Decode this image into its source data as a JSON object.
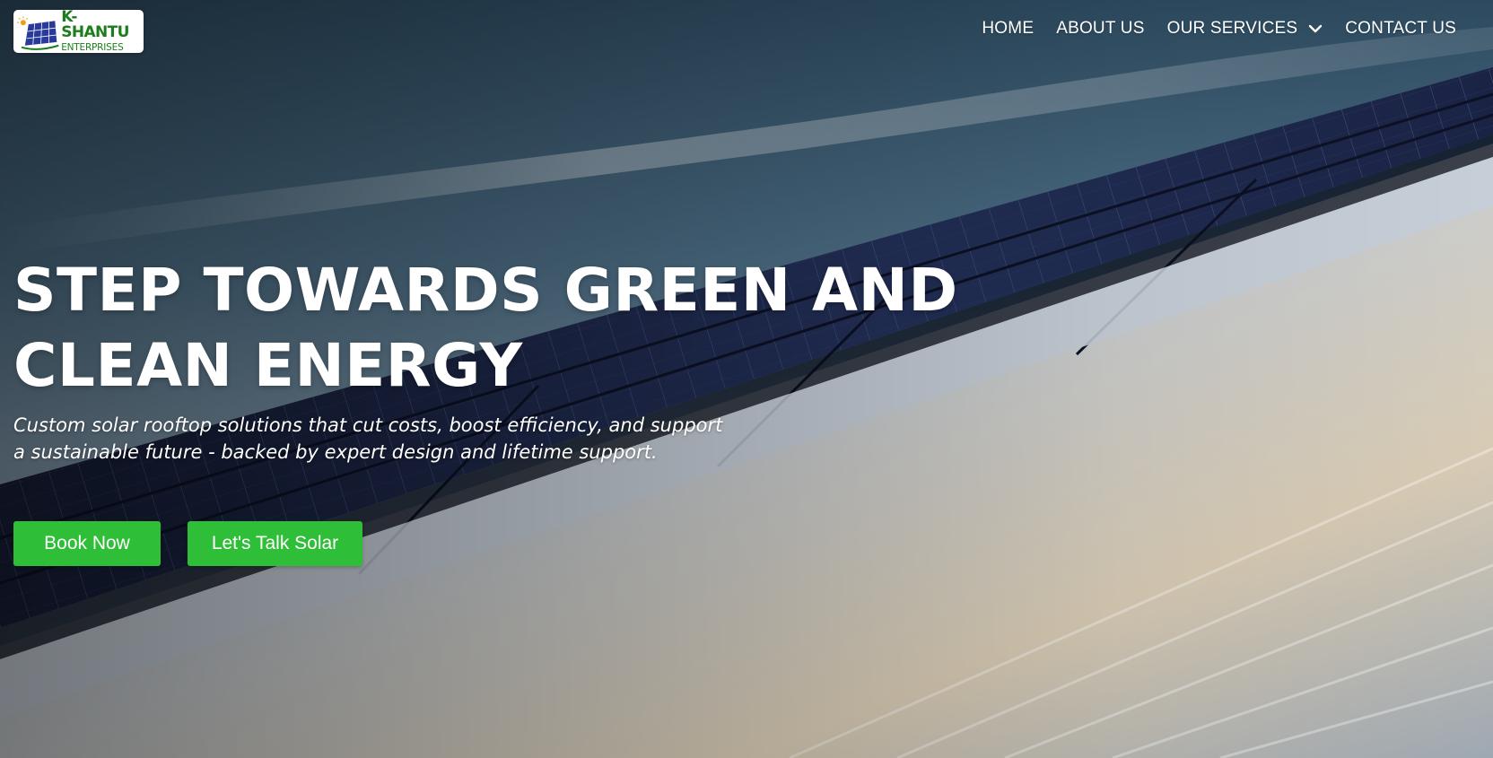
{
  "brand": {
    "name": "K-SHANTU",
    "tagline": "ENTERPRISES"
  },
  "nav": {
    "items": [
      {
        "label": "HOME"
      },
      {
        "label": "ABOUT US"
      },
      {
        "label": "OUR SERVICES",
        "icon": "chevron-down-icon"
      },
      {
        "label": "CONTACT US"
      }
    ]
  },
  "hero": {
    "headline_line1": "STEP TOWARDS GREEN AND",
    "headline_line2": "CLEAN ENERGY",
    "subtitle_line1": "Custom solar rooftop solutions that cut costs, boost efficiency, and support",
    "subtitle_line2": "a sustainable future - backed by expert design and lifetime support.",
    "primary_button": "Book Now",
    "secondary_button": "Let's Talk Solar"
  },
  "colors": {
    "accent_green": "#2fbe37",
    "brand_green": "#1b7d1b",
    "text": "#ffffff"
  }
}
